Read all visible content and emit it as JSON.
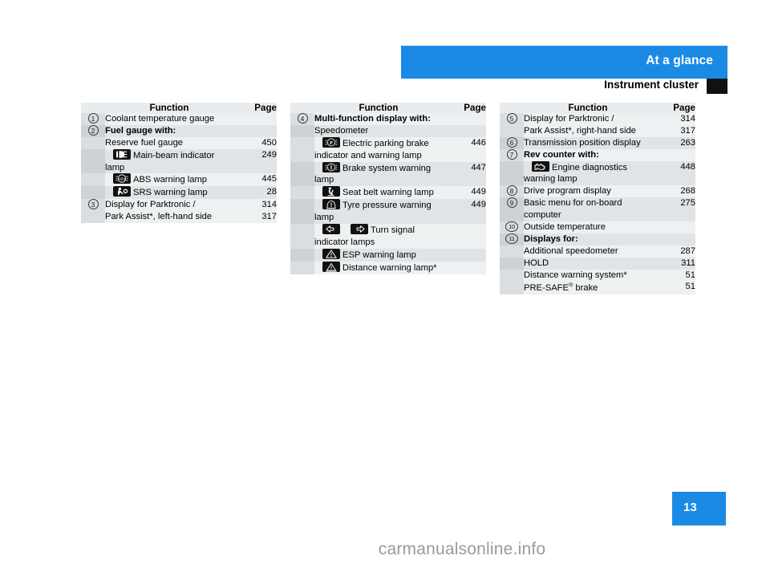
{
  "header": {
    "title": "At a glance",
    "subtitle": "Instrument cluster",
    "band_color": "#1b8ae5",
    "marker_color": "#111111"
  },
  "footer": {
    "page_number": "13",
    "badge_color": "#1b8ae5",
    "watermark": "carmanualsonline.info"
  },
  "columns": {
    "header_function": "Function",
    "header_page": "Page"
  },
  "tables": [
    {
      "id": "table-left",
      "rows": [
        {
          "num": "1",
          "function": "Coolant temperature gauge",
          "page": "",
          "bold": false
        },
        {
          "num": "2",
          "function": "Fuel gauge with:",
          "page": "",
          "bold": true
        },
        {
          "num": "",
          "function": "Reserve fuel gauge",
          "page": "450",
          "bold": false
        },
        {
          "num": "",
          "icon": "main-beam-indicator-icon",
          "function": "Main-beam indicator lamp",
          "page": "249",
          "bold": false
        },
        {
          "num": "",
          "icon": "abs-warning-icon",
          "function": "ABS warning lamp",
          "page": "445",
          "bold": false
        },
        {
          "num": "",
          "icon": "srs-warning-icon",
          "function": "SRS warning lamp",
          "page": "28",
          "bold": false
        },
        {
          "num": "3",
          "function": "Display for Parktronic /\nPark Assist*, left-hand side",
          "page": "314\n317",
          "bold": false
        }
      ]
    },
    {
      "id": "table-mid",
      "rows": [
        {
          "num": "4",
          "function": "Multi-function display with:",
          "page": "",
          "bold": true
        },
        {
          "num": "",
          "function": "Speedometer",
          "page": "",
          "bold": false
        },
        {
          "num": "",
          "icon": "electric-parking-brake-icon",
          "function": "Electric parking brake indicator and warning lamp",
          "page": "446",
          "bold": false
        },
        {
          "num": "",
          "icon": "brake-system-warning-icon",
          "function": "Brake system warning lamp",
          "page": "447",
          "bold": false
        },
        {
          "num": "",
          "icon": "seat-belt-warning-icon",
          "function": "Seat belt warning lamp",
          "page": "449",
          "bold": false
        },
        {
          "num": "",
          "icon": "tyre-pressure-warning-icon",
          "function": "Tyre pressure warning lamp",
          "page": "449",
          "bold": false
        },
        {
          "num": "",
          "icon": "turn-signal-icons",
          "function": "Turn signal indicator lamps",
          "page": "",
          "bold": false
        },
        {
          "num": "",
          "icon": "esp-warning-icon",
          "function": "ESP warning lamp",
          "page": "",
          "bold": false
        },
        {
          "num": "",
          "icon": "distance-warning-icon",
          "function": "Distance warning lamp*",
          "page": "",
          "bold": false
        }
      ]
    },
    {
      "id": "table-right",
      "rows": [
        {
          "num": "5",
          "function": "Display for Parktronic /\nPark Assist*, right-hand side",
          "page": "314\n317",
          "bold": false
        },
        {
          "num": "6",
          "function": "Transmission position display",
          "page": "263",
          "bold": false
        },
        {
          "num": "7",
          "function": "Rev counter with:",
          "page": "",
          "bold": true
        },
        {
          "num": "",
          "icon": "engine-diagnostics-icon",
          "function": "Engine diagnostics warning lamp",
          "page": "448",
          "bold": false
        },
        {
          "num": "8",
          "function": "Drive program display",
          "page": "268",
          "bold": false
        },
        {
          "num": "9",
          "function": "Basic menu for on-board computer",
          "page": "275",
          "bold": false
        },
        {
          "num": "10",
          "function": "Outside temperature",
          "page": "",
          "bold": false
        },
        {
          "num": "11",
          "function": "Displays for:",
          "page": "",
          "bold": true
        },
        {
          "num": "",
          "function": "Additional speedometer",
          "page": "287",
          "bold": false
        },
        {
          "num": "",
          "function": "HOLD",
          "page": "311",
          "bold": false
        },
        {
          "num": "",
          "function": "Distance warning system*\nPRE-SAFE® brake",
          "page": "51\n51",
          "bold": false
        }
      ]
    }
  ]
}
